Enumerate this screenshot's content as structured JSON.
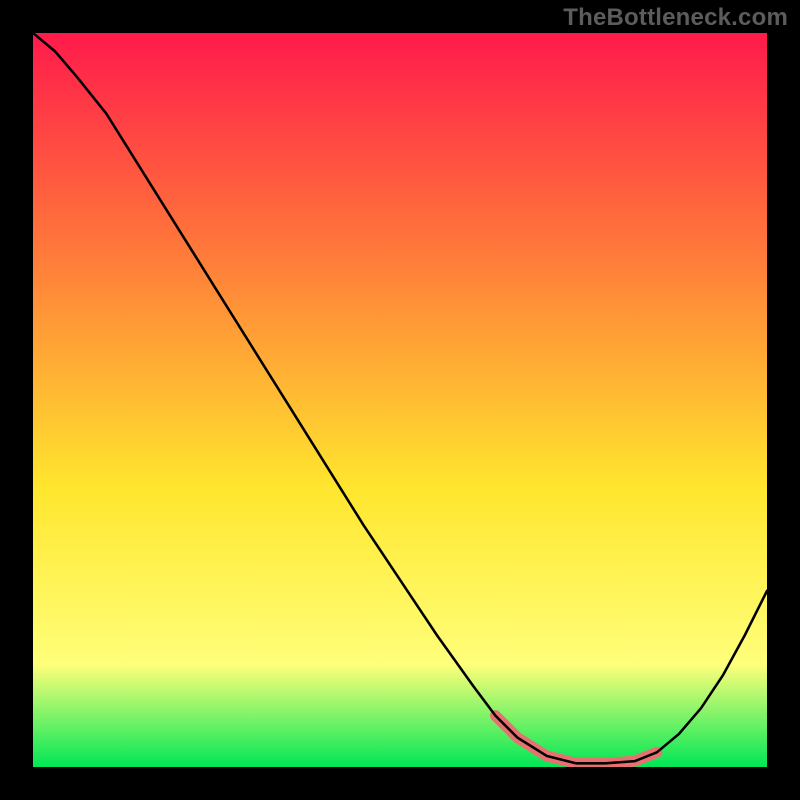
{
  "watermark": "TheBottleneck.com",
  "colors": {
    "gradient_top": "#ff1a4b",
    "gradient_mid1": "#ff7a3a",
    "gradient_mid2": "#ffe62e",
    "gradient_mid3": "#ffff7a",
    "gradient_bottom": "#00e756",
    "curve": "#000000",
    "band": "#e8716f",
    "frame": "#000000"
  },
  "chart_data": {
    "type": "line",
    "title": "",
    "xlabel": "",
    "ylabel": "",
    "xlim": [
      0,
      100
    ],
    "ylim": [
      0,
      100
    ],
    "series": [
      {
        "name": "bottleneck-curve",
        "x": [
          0,
          3,
          6,
          10,
          15,
          20,
          25,
          30,
          35,
          40,
          45,
          50,
          55,
          60,
          63,
          66,
          70,
          74,
          78,
          82,
          85,
          88,
          91,
          94,
          97,
          100
        ],
        "y": [
          100,
          97.5,
          94,
          89,
          81,
          73,
          65,
          57,
          49,
          41,
          33,
          25.5,
          18,
          11,
          7,
          4,
          1.5,
          0.5,
          0.5,
          0.8,
          2,
          4.5,
          8,
          12.5,
          18,
          24
        ]
      }
    ],
    "optimal_band": {
      "name": "optimal-range",
      "x_start": 62,
      "x_end": 86,
      "thickness": 1.5
    }
  }
}
